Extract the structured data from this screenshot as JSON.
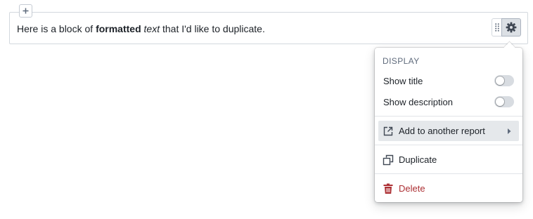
{
  "widget": {
    "text_plain_1": "Here is a block of ",
    "text_bold": "formatted",
    "text_plain_2": " ",
    "text_italic": "text",
    "text_plain_3": " that I'd like to duplicate."
  },
  "icons": {
    "add": "plus-icon",
    "drag": "drag-handle-icon",
    "settings": "gear-icon",
    "share": "share-icon",
    "duplicate": "duplicate-icon",
    "delete": "trash-icon",
    "submenu": "caret-right-icon"
  },
  "menu": {
    "heading": "DISPLAY",
    "show_title": {
      "label": "Show title",
      "enabled": false
    },
    "show_description": {
      "label": "Show description",
      "enabled": false
    },
    "add_to_report": "Add to another report",
    "duplicate": "Duplicate",
    "delete": "Delete"
  },
  "colors": {
    "danger": "#ac2f33",
    "hover_bg": "#e5e8eb",
    "settings_active_bg": "#dce0e5",
    "toggle_off": "#d8dce1"
  }
}
